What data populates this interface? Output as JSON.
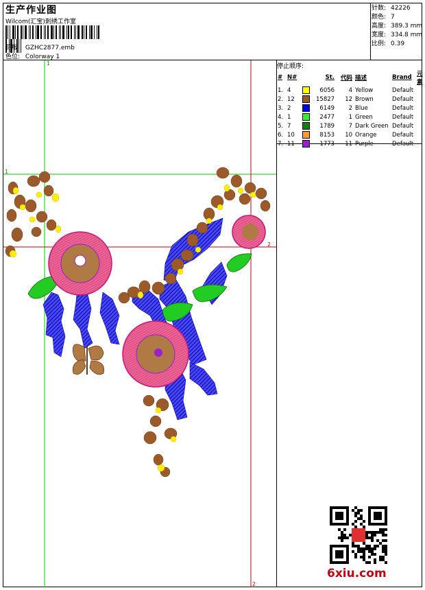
{
  "header": {
    "title": "生产作业图",
    "company": "Wilcom(汇宝)刺绣工作室",
    "design_label": "花版:",
    "design_value": "GZHC2877.emb",
    "colorway_label": "色位:",
    "colorway_value": "Colorway 1"
  },
  "stats": [
    {
      "label": "针数:",
      "value": "42226"
    },
    {
      "label": "颜色:",
      "value": "7"
    },
    {
      "label": "高度:",
      "value": "389.3 mm"
    },
    {
      "label": "宽度:",
      "value": "334.8 mm"
    },
    {
      "label": "比例:",
      "value": "0.39"
    }
  ],
  "color_table": {
    "title": "停止顺序:",
    "headers": [
      "#",
      "N#",
      "St.",
      "代码",
      "描述",
      "Brand",
      "元素"
    ],
    "rows": [
      {
        "idx": "1.",
        "n": "4",
        "color": "#ffff00",
        "st": "6056",
        "code": "4",
        "desc": "Yellow",
        "brand": "Default"
      },
      {
        "idx": "2.",
        "n": "12",
        "color": "#9c5a2a",
        "st": "15827",
        "code": "12",
        "desc": "Brown",
        "brand": "Default"
      },
      {
        "idx": "3.",
        "n": "2",
        "color": "#0000ee",
        "st": "6149",
        "code": "2",
        "desc": "Blue",
        "brand": "Default"
      },
      {
        "idx": "4.",
        "n": "1",
        "color": "#33ee33",
        "st": "2477",
        "code": "1",
        "desc": "Green",
        "brand": "Default"
      },
      {
        "idx": "5.",
        "n": "7",
        "color": "#108010",
        "st": "1789",
        "code": "7",
        "desc": "Dark Green",
        "brand": "Default"
      },
      {
        "idx": "6.",
        "n": "10",
        "color": "#ff9933",
        "st": "8153",
        "code": "10",
        "desc": "Orange",
        "brand": "Default"
      },
      {
        "idx": "7.",
        "n": "11",
        "color": "#9b1ed0",
        "st": "1773",
        "code": "11",
        "desc": "Purple",
        "brand": "Default"
      }
    ]
  },
  "guides": {
    "h1": "1",
    "h2": "2",
    "v1": "1",
    "v2": "2"
  },
  "watermark": "6xiu.com"
}
